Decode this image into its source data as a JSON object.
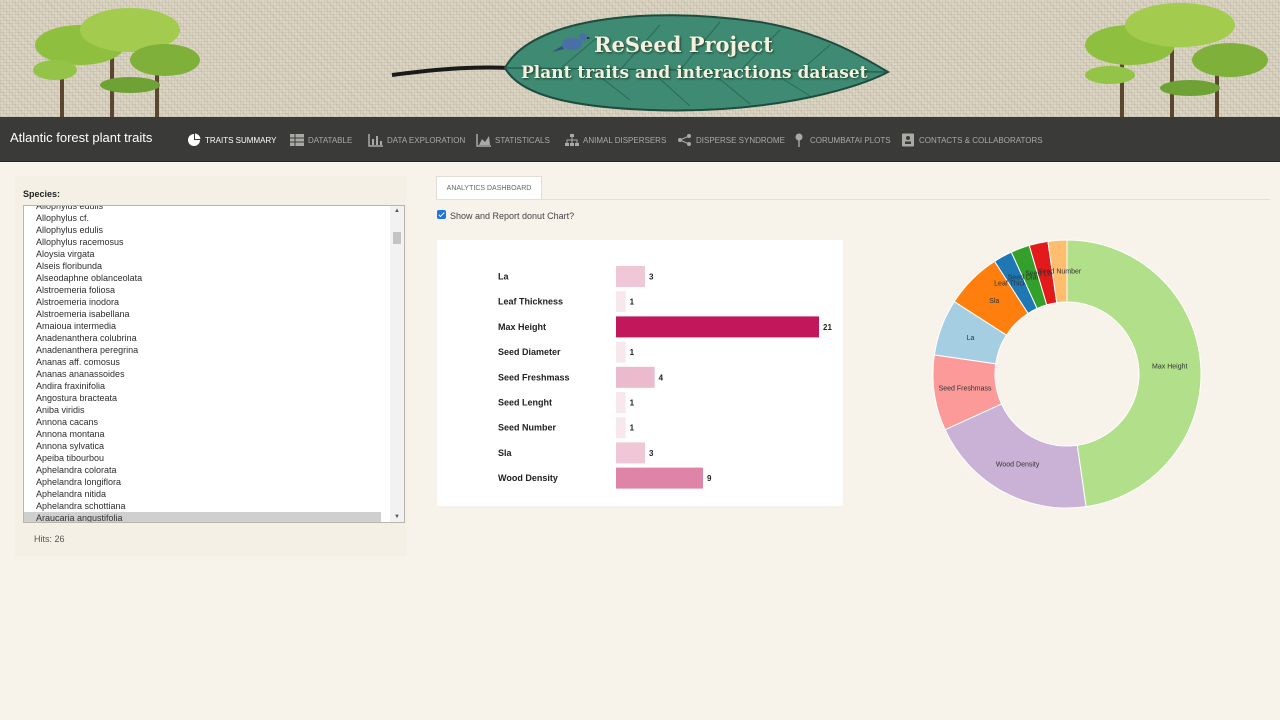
{
  "banner": {
    "title": "ReSeed Project",
    "subtitle": "Plant traits and interactions dataset"
  },
  "navbar": {
    "brand": "Atlantic forest plant traits",
    "items": [
      {
        "label": "Traits Summary",
        "icon": "pie-chart-icon",
        "active": true
      },
      {
        "label": "Datatable",
        "icon": "table-icon",
        "active": false
      },
      {
        "label": "Data Exploration",
        "icon": "bar-chart-icon",
        "active": false
      },
      {
        "label": "Statisticals",
        "icon": "area-chart-icon",
        "active": false
      },
      {
        "label": "Animal Dispersers",
        "icon": "sitemap-icon",
        "active": false
      },
      {
        "label": "Disperse Syndrome",
        "icon": "share-icon",
        "active": false
      },
      {
        "label": "Corumbatai Plots",
        "icon": "map-pin-icon",
        "active": false
      },
      {
        "label": "Contacts & Collaborators",
        "icon": "contact-card-icon",
        "active": false
      }
    ]
  },
  "sidebar": {
    "label": "Species:",
    "species": [
      "Allophylus edulis",
      "Allophylus cf.",
      "Allophylus edulis",
      "Allophylus racemosus",
      "Aloysia virgata",
      "Alseis floribunda",
      "Alseodaphne oblanceolata",
      "Alstroemeria foliosa",
      "Alstroemeria inodora",
      "Alstroemeria isabellana",
      "Amaioua intermedia",
      "Anadenanthera colubrina",
      "Anadenanthera peregrina",
      "Ananas aff. comosus",
      "Ananas ananassoides",
      "Andira fraxinifolia",
      "Angostura bracteata",
      "Aniba viridis",
      "Annona cacans",
      "Annona montana",
      "Annona sylvatica",
      "Apeiba tibourbou",
      "Aphelandra colorata",
      "Aphelandra longiflora",
      "Aphelandra nitida",
      "Aphelandra schottiana",
      "Araucaria angustifolia"
    ],
    "selected": "Araucaria angustifolia",
    "hits": "Hits: 26"
  },
  "main": {
    "tab": "Analytics Dashboard",
    "checkbox_label": "Show and Report donut Chart?",
    "checkbox_checked": true
  },
  "chart_data": [
    {
      "type": "bar",
      "orientation": "horizontal",
      "categories": [
        "La",
        "Leaf Thickness",
        "Max Height",
        "Seed Diameter",
        "Seed Freshmass",
        "Seed Lenght",
        "Seed Number",
        "Sla",
        "Wood Density"
      ],
      "values": [
        3,
        1,
        21,
        1,
        4,
        1,
        1,
        3,
        9
      ],
      "color_low": "#f7e8ed",
      "color_high": "#c2185b"
    },
    {
      "type": "pie",
      "style": "donut",
      "labels": [
        "Max Height",
        "Wood Density",
        "Seed Freshmass",
        "La",
        "Sla",
        "Leaf Thickness",
        "Seed Diameter",
        "Seed Lenght",
        "Seed Number"
      ],
      "values": [
        21,
        9,
        4,
        3,
        3,
        1,
        1,
        1,
        1
      ],
      "colors": [
        "#b2df8a",
        "#cab2d6",
        "#fb9a99",
        "#a6cee3",
        "#ff7f0e",
        "#1f78b4",
        "#33a02c",
        "#e31a1c",
        "#fdbf6f"
      ]
    }
  ]
}
